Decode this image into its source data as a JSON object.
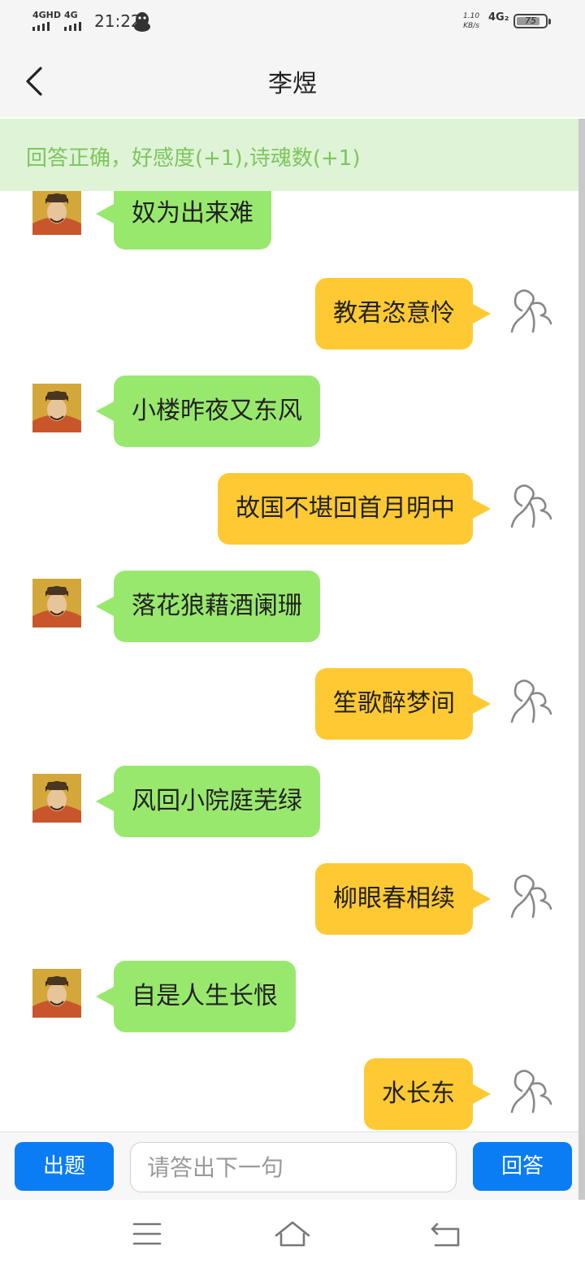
{
  "status_bar": {
    "network1": "4GHD",
    "network2": "4G",
    "time": "21:22",
    "speed_value": "1.10",
    "speed_unit": "KB/s",
    "network3": "4G₂",
    "battery": "75"
  },
  "header": {
    "title": "李煜"
  },
  "notice": {
    "text": "回答正确，好感度(+1),诗魂数(+1)"
  },
  "messages": [
    {
      "side": "left",
      "text": "奴为出来难"
    },
    {
      "side": "right",
      "text": "教君恣意怜"
    },
    {
      "side": "left",
      "text": "小楼昨夜又东风"
    },
    {
      "side": "right",
      "text": "故国不堪回首月明中"
    },
    {
      "side": "left",
      "text": "落花狼藉酒阑珊"
    },
    {
      "side": "right",
      "text": "笙歌醉梦间"
    },
    {
      "side": "left",
      "text": "风回小院庭芜绿"
    },
    {
      "side": "right",
      "text": "柳眼春相续"
    },
    {
      "side": "left",
      "text": "自是人生长恨"
    },
    {
      "side": "right",
      "text": "水长东"
    }
  ],
  "input_bar": {
    "ask_label": "出题",
    "placeholder": "请答出下一句",
    "answer_label": "回答"
  },
  "colors": {
    "left_bubble": "#99e86e",
    "right_bubble": "#ffc933",
    "notice_bg": "#dff3d6",
    "notice_text": "#7cc65d",
    "button_blue": "#0a7df5"
  },
  "icons": {
    "back": "chevron-left-icon",
    "menu": "menu-icon",
    "home": "home-icon",
    "return": "return-icon"
  }
}
